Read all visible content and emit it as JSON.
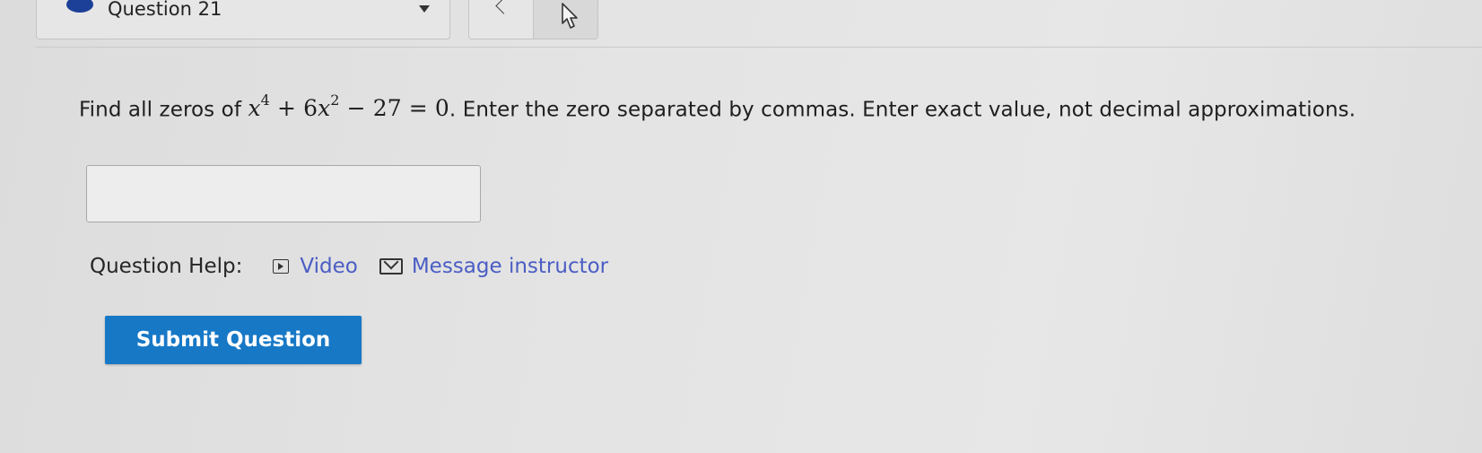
{
  "header": {
    "question_label": "Question 21",
    "status_color": "#1c3f98"
  },
  "navigation": {
    "prev_icon": "chevron-left-icon",
    "cursor_icon": "mouse-pointer-icon"
  },
  "question": {
    "text_before": "Find all zeros of ",
    "equation": {
      "var": "x",
      "exp1": "4",
      "op1": " + 6",
      "exp2": "2",
      "rest": " − 27 = 0"
    },
    "text_after": ". Enter the zero separated by commas. Enter exact value, not decimal approximations."
  },
  "answer": {
    "value": "",
    "placeholder": ""
  },
  "help": {
    "label": "Question Help:",
    "video_label": "Video",
    "message_label": "Message instructor",
    "link_color": "#4a5dc4"
  },
  "submit": {
    "label": "Submit Question",
    "color": "#1778c6"
  }
}
